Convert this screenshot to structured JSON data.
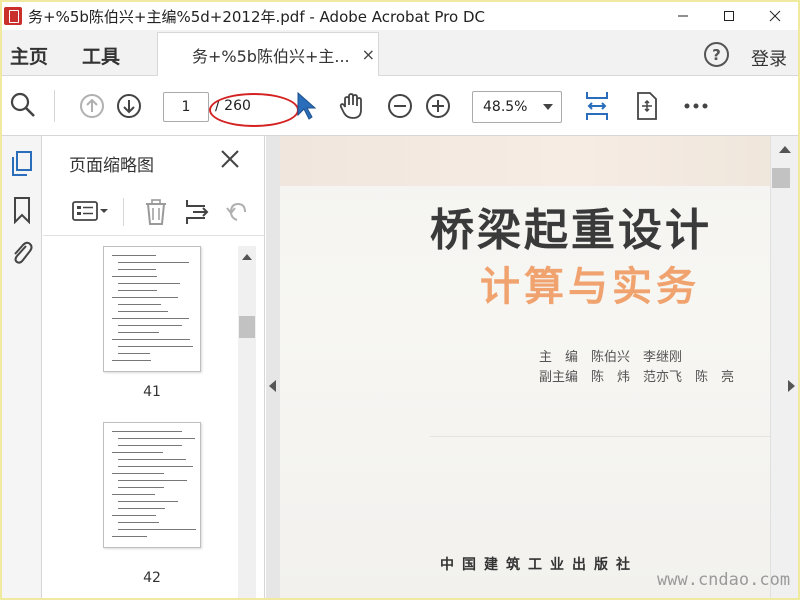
{
  "window": {
    "title": "务+%5b陈伯兴+主编%5d+2012年.pdf - Adobe Acrobat Pro DC"
  },
  "menu": {
    "home": "主页",
    "tools": "工具",
    "help": "?",
    "login": "登录"
  },
  "tab": {
    "label": "务+%5b陈伯兴+主...",
    "close": "×"
  },
  "toolbar": {
    "current_page": "1",
    "total_pages": "/ 260",
    "zoom": "48.5%"
  },
  "thumbnails": {
    "title": "页面缩略图",
    "pages": [
      {
        "number": "41"
      },
      {
        "number": "42"
      }
    ]
  },
  "document": {
    "title": "桥梁起重设计",
    "subtitle": "计算与实务",
    "editor_line": "主　编　陈伯兴　李继刚",
    "coeditor_line": "副主编　陈　炜　范亦飞　陈　亮",
    "publisher": "中国建筑工业出版社"
  },
  "watermark": "www.cndao.com",
  "colors": {
    "annotation": "#d42222",
    "subtitle": "#f0a36e",
    "accent_blue": "#2a6ebb"
  },
  "icons": {
    "search": "search-icon",
    "prev_page": "arrow-up-circle-icon",
    "next_page": "arrow-down-circle-icon",
    "select": "cursor-arrow-icon",
    "hand": "hand-icon",
    "zoom_out": "zoom-out-icon",
    "zoom_in": "zoom-in-icon",
    "fit": "fit-width-icon",
    "scroll_mode": "scroll-mode-icon",
    "more": "more-icon"
  }
}
